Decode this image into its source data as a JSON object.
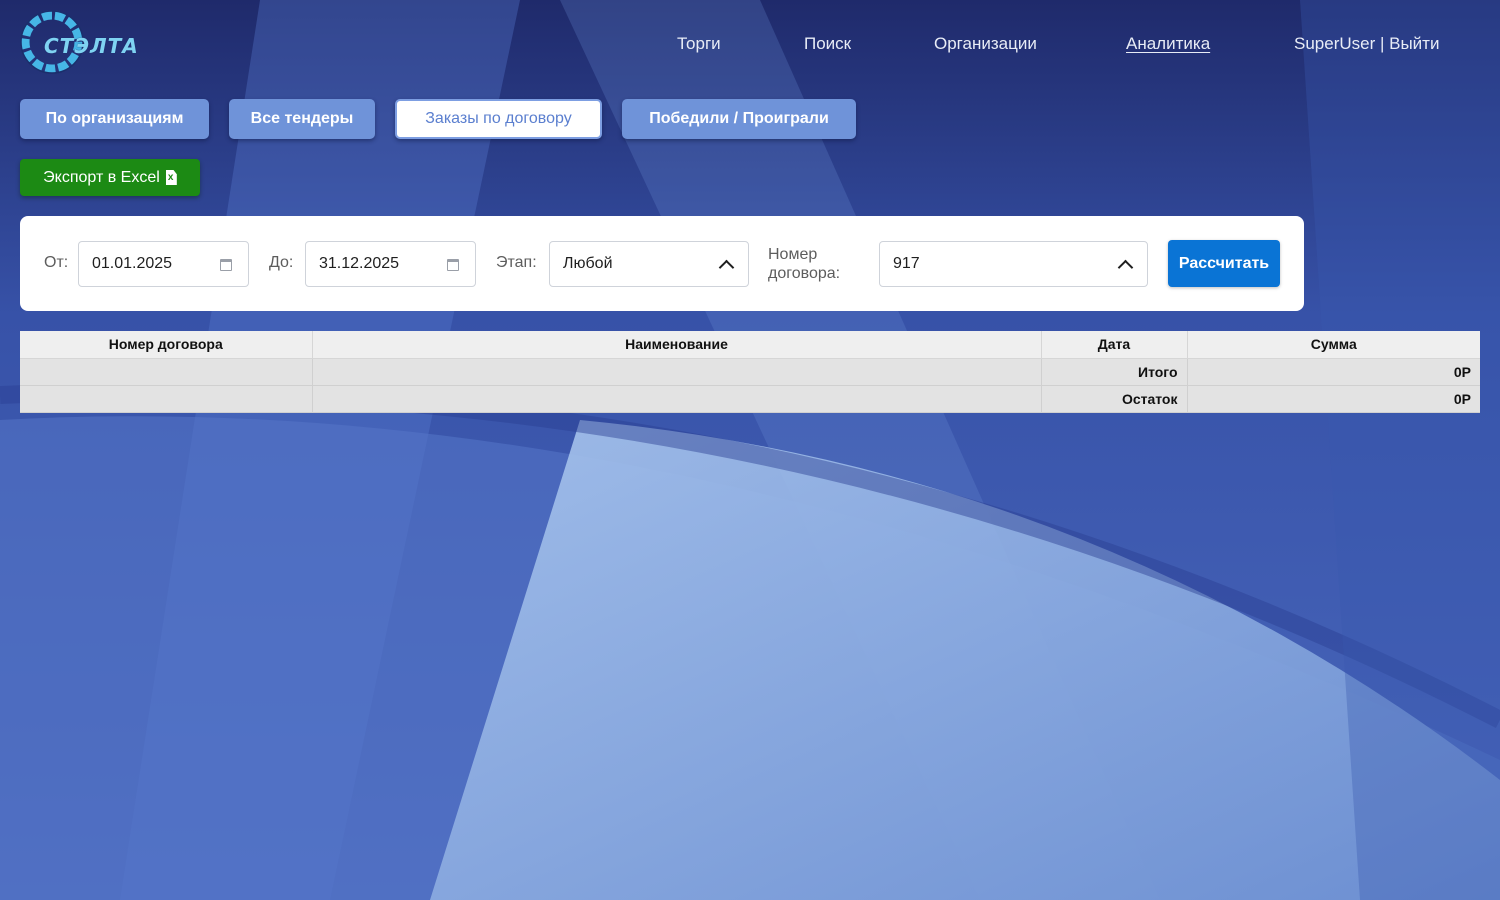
{
  "logo": {
    "text": "СТЭЛТА"
  },
  "nav": {
    "items": [
      {
        "label": "Торги"
      },
      {
        "label": "Поиск"
      },
      {
        "label": "Организации"
      },
      {
        "label": "Аналитика"
      }
    ],
    "user": "SuperUser | Выйти"
  },
  "tabs": [
    {
      "label": "По организациям"
    },
    {
      "label": "Все тендеры"
    },
    {
      "label": "Заказы по договору",
      "active": true
    },
    {
      "label": "Победили / Проиграли"
    }
  ],
  "export": {
    "label": "Экспорт в Excel",
    "icon": "file-excel-icon"
  },
  "filters": {
    "from_label": "От:",
    "from_value": "01.01.2025",
    "to_label": "До:",
    "to_value": "31.12.2025",
    "stage_label": "Этап:",
    "stage_value": "Любой",
    "contract_label_1": "Номер",
    "contract_label_2": "договора:",
    "contract_value": "917",
    "calc_label": "Рассчитать"
  },
  "table": {
    "headers": [
      "Номер договора",
      "Наименование",
      "Дата",
      "Сумма"
    ],
    "rows": [
      [
        "",
        "",
        "Итого",
        "0Р"
      ],
      [
        "",
        "",
        "Остаток",
        "0Р"
      ]
    ]
  },
  "colors": {
    "background": "#3f5fb0",
    "tab": "#6f93d9",
    "export": "#1c8a14",
    "calc": "#0a74d5"
  }
}
